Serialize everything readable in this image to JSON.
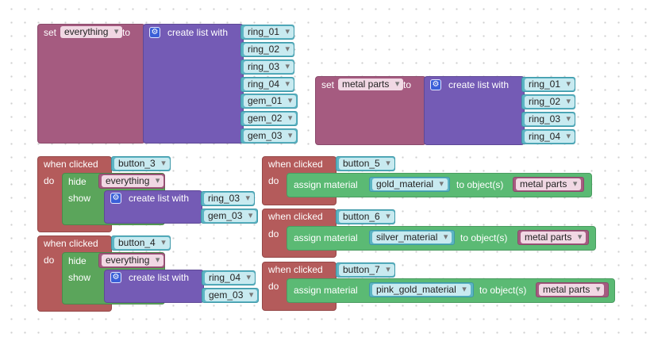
{
  "keywords": {
    "set": "set",
    "to": "to",
    "create_list_with": "create list with",
    "when_clicked": "when clicked",
    "do": "do",
    "hide": "hide",
    "show": "show",
    "assign_material": "assign material",
    "to_objects": "to object(s)"
  },
  "icons": {
    "gear": "gear-icon",
    "dropdown": "triangle-down-icon"
  },
  "colors": {
    "variable_block": "#a55b80",
    "list_block": "#745bb5",
    "event_block": "#b45b5b",
    "hide_show_block": "#5ba55b",
    "assign_block": "#5bba74",
    "item_block": "#5cb4c4",
    "gear_icon": "#3a5fd8"
  },
  "blocks": {
    "set_everything": {
      "variable": "everything",
      "items": [
        "ring_01",
        "ring_02",
        "ring_03",
        "ring_04",
        "gem_01",
        "gem_02",
        "gem_03"
      ]
    },
    "set_metal_parts": {
      "variable": "metal parts",
      "items": [
        "ring_01",
        "ring_02",
        "ring_03",
        "ring_04"
      ]
    },
    "button_3": {
      "button": "button_3",
      "hide": "everything",
      "show": [
        "ring_03",
        "gem_03"
      ]
    },
    "button_4": {
      "button": "button_4",
      "hide": "everything",
      "show": [
        "ring_04",
        "gem_03"
      ]
    },
    "button_5": {
      "button": "button_5",
      "material": "gold_material",
      "objects": "metal parts"
    },
    "button_6": {
      "button": "button_6",
      "material": "silver_material",
      "objects": "metal parts"
    },
    "button_7": {
      "button": "button_7",
      "material": "pink_gold_material",
      "objects": "metal parts"
    }
  }
}
